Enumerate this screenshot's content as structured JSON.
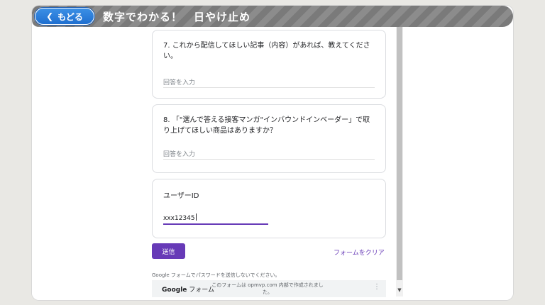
{
  "header": {
    "back_label": "もどる",
    "title": "数字でわかる！　日やけ止め"
  },
  "form": {
    "questions": [
      {
        "text": "7. これから配信してほしい記事（内容）があれば、教えてください。",
        "placeholder": "回答を入力"
      },
      {
        "text": "8. 「\"選んで答える接客マンガ\"インバウンドインベーダー」で取り上げてほしい商品はありますか？",
        "placeholder": "回答を入力"
      }
    ],
    "user_id": {
      "label": "ユーザーID",
      "value": "xxx12345"
    },
    "submit_label": "送信",
    "clear_label": "フォームをクリア",
    "password_warning": "Google フォームでパスワードを送信しないでください。",
    "footer": {
      "brand_google": "Google",
      "brand_forms": "フォーム",
      "note": "このフォームは opmvp.com 内部で作成されました。"
    }
  },
  "colors": {
    "accent": "#673ab7",
    "back_button": "#1f6fd0",
    "header_bg": "#7a7a7a"
  }
}
